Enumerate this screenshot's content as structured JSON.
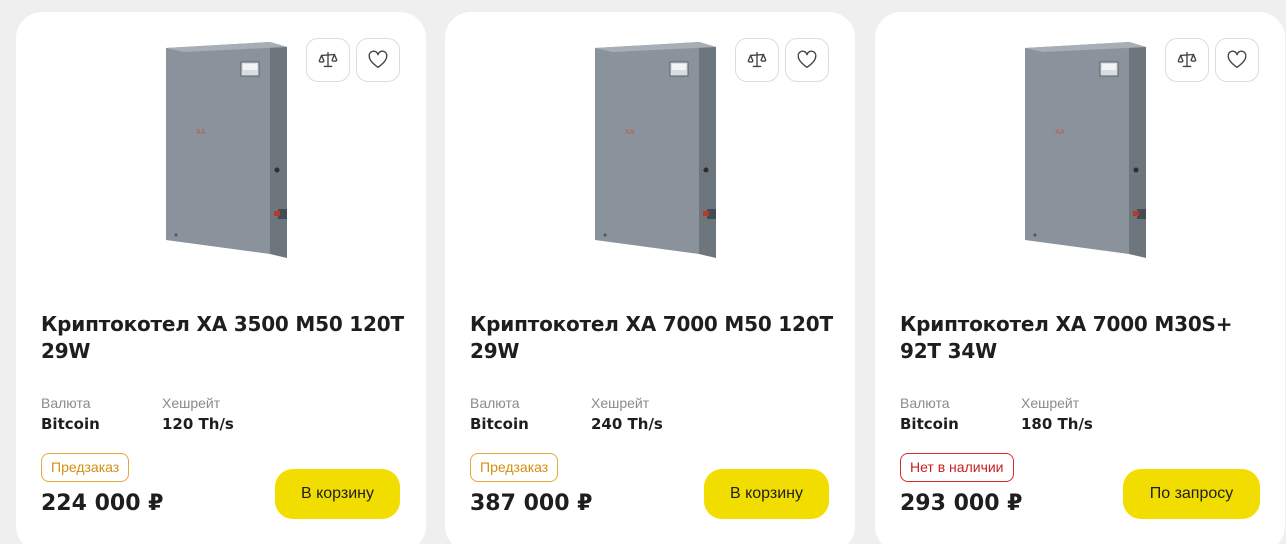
{
  "products": [
    {
      "title": "Криптокотел XA 3500 M50 120T 29W",
      "currency_label": "Валюта",
      "currency_value": "Bitcoin",
      "hashrate_label": "Хешрейт",
      "hashrate_value": "120 Th/s",
      "badge": "Предзаказ",
      "price": "224 000 ₽",
      "button_label": "В корзину"
    },
    {
      "title": "Криптокотел XA 7000 M50 120T 29W",
      "currency_label": "Валюта",
      "currency_value": "Bitcoin",
      "hashrate_label": "Хешрейт",
      "hashrate_value": "240 Th/s",
      "badge": "Предзаказ",
      "price": "387 000 ₽",
      "button_label": "В корзину"
    },
    {
      "title": "Криптокотел XA 7000 M30S+ 92T 34W",
      "currency_label": "Валюта",
      "currency_value": "Bitcoin",
      "hashrate_label": "Хешрейт",
      "hashrate_value": "180 Th/s",
      "badge": "Нет в наличии",
      "price": "293 000 ₽",
      "button_label": "По запросу"
    }
  ],
  "icons": {
    "compare": "scales-icon",
    "favorite": "heart-icon"
  },
  "colors": {
    "button": "#f2dd00",
    "preorder": "#d48f10",
    "out_of_stock": "#c81e1e"
  }
}
